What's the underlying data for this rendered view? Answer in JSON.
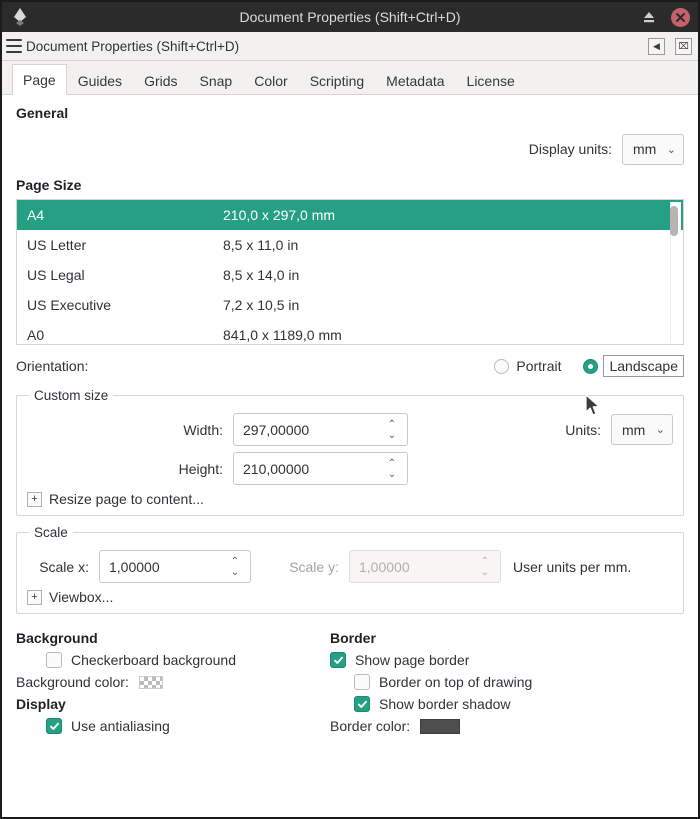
{
  "window": {
    "title": "Document Properties (Shift+Ctrl+D)",
    "logo_icon": "inkscape-logo-icon",
    "eject_icon": "eject-icon",
    "close_icon": "close-icon"
  },
  "panel": {
    "title": "Document Properties (Shift+Ctrl+D)",
    "menu_icon": "hamburger-menu-icon",
    "dock_label": "◀",
    "close_label": "⌧"
  },
  "tabs": [
    {
      "label": "Page",
      "active": true
    },
    {
      "label": "Guides",
      "active": false
    },
    {
      "label": "Grids",
      "active": false
    },
    {
      "label": "Snap",
      "active": false
    },
    {
      "label": "Color",
      "active": false
    },
    {
      "label": "Scripting",
      "active": false
    },
    {
      "label": "Metadata",
      "active": false
    },
    {
      "label": "License",
      "active": false
    }
  ],
  "general": {
    "heading": "General",
    "display_units_label": "Display units:",
    "display_units_value": "mm",
    "chevron": "⌄"
  },
  "page_size": {
    "heading": "Page Size",
    "rows": [
      {
        "name": "A4",
        "dims": "210,0 x 297,0 mm",
        "selected": true
      },
      {
        "name": "US Letter",
        "dims": "8,5 x 11,0 in",
        "selected": false
      },
      {
        "name": "US Legal",
        "dims": "8,5 x 14,0 in",
        "selected": false
      },
      {
        "name": "US Executive",
        "dims": "7,2 x 10,5 in",
        "selected": false
      },
      {
        "name": "A0",
        "dims": "841,0 x 1189,0 mm",
        "selected": false
      }
    ]
  },
  "orientation": {
    "label": "Orientation:",
    "portrait_label": "Portrait",
    "landscape_label": "Landscape",
    "selected": "Landscape"
  },
  "custom_size": {
    "legend": "Custom size",
    "width_label": "Width:",
    "width_value": "297,00000",
    "height_label": "Height:",
    "height_value": "210,00000",
    "units_label": "Units:",
    "units_value": "mm",
    "chevron": "⌄",
    "up_arrow": "⌃",
    "down_arrow": "⌄",
    "resize_expander_sign": "+",
    "resize_label": "Resize page to content..."
  },
  "scale": {
    "legend": "Scale",
    "scale_x_label": "Scale x:",
    "scale_x_value": "1,00000",
    "scale_y_label": "Scale y:",
    "scale_y_value": "1,00000",
    "units_text": "User units per mm.",
    "up_arrow": "⌃",
    "down_arrow": "⌄",
    "viewbox_expander_sign": "+",
    "viewbox_label": "Viewbox..."
  },
  "background": {
    "heading": "Background",
    "checkerboard_label": "Checkerboard background",
    "checkerboard_checked": false,
    "color_label": "Background color:",
    "color_swatch": "checkerboard-transparent"
  },
  "display": {
    "heading": "Display",
    "antialiasing_label": "Use antialiasing",
    "antialiasing_checked": true
  },
  "border": {
    "heading": "Border",
    "show_page_border_label": "Show page border",
    "show_page_border_checked": true,
    "border_on_top_label": "Border on top of drawing",
    "border_on_top_checked": false,
    "show_shadow_label": "Show border shadow",
    "show_shadow_checked": true,
    "color_label": "Border color:",
    "color_swatch": "#4e4e4e"
  },
  "colors": {
    "accent_teal": "#26a085",
    "titlebar": "#2b2b2b",
    "close_red": "#c4626c"
  }
}
